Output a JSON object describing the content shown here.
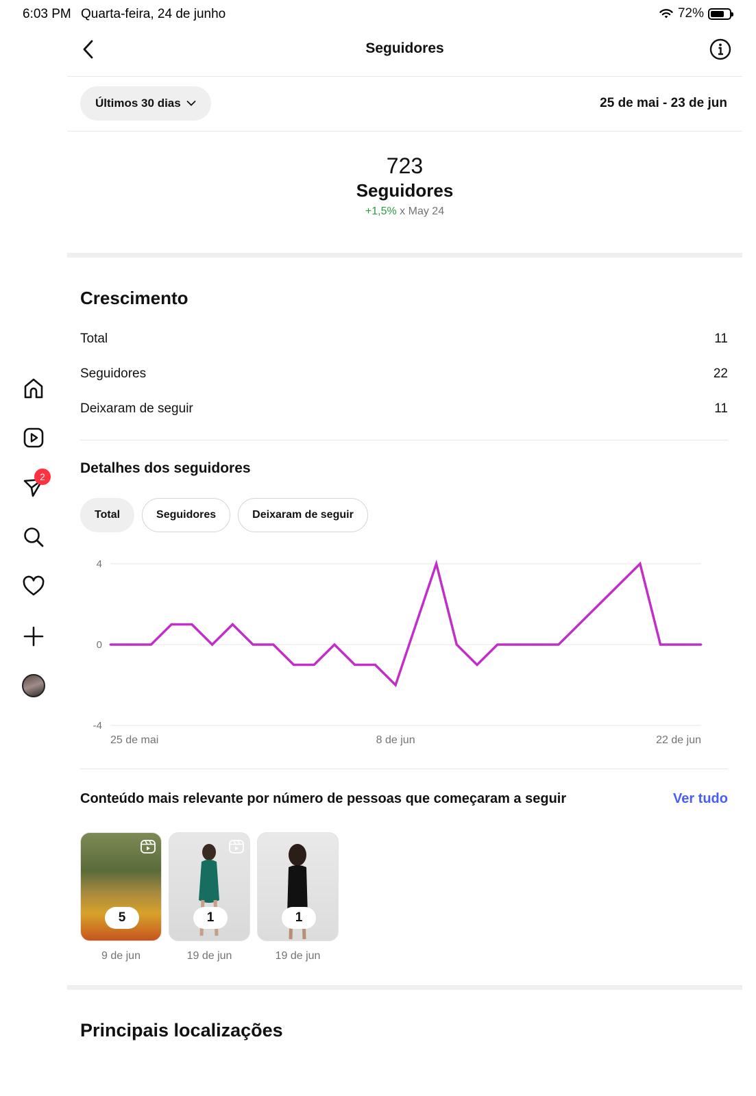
{
  "status_bar": {
    "time": "6:03 PM",
    "date": "Quarta-feira, 24 de junho",
    "battery": "72%",
    "battery_level": 0.72
  },
  "sidebar": {
    "items": [
      {
        "name": "home-icon"
      },
      {
        "name": "reels-icon"
      },
      {
        "name": "messages-icon",
        "badge": "2"
      },
      {
        "name": "search-icon"
      },
      {
        "name": "heart-icon"
      },
      {
        "name": "plus-icon"
      },
      {
        "name": "profile-avatar"
      }
    ]
  },
  "header": {
    "title": "Seguidores"
  },
  "filter": {
    "label": "Últimos 30 dias",
    "range": "25 de mai - 23 de jun"
  },
  "summary": {
    "count": "723",
    "label": "Seguidores",
    "delta": "+1,5%",
    "comparison": "x May 24"
  },
  "growth": {
    "title": "Crescimento",
    "rows": [
      {
        "label": "Total",
        "value": "11"
      },
      {
        "label": "Seguidores",
        "value": "22"
      },
      {
        "label": "Deixaram de seguir",
        "value": "11"
      }
    ]
  },
  "details": {
    "title": "Detalhes dos seguidores",
    "pills": [
      "Total",
      "Seguidores",
      "Deixaram de seguir"
    ],
    "active_pill": "Total"
  },
  "chart_data": {
    "type": "line",
    "color": "#c12fc6",
    "ylim": [
      -4,
      4
    ],
    "y_ticks": [
      "4",
      "0",
      "-4"
    ],
    "x_tick_labels": [
      "25 de mai",
      "8 de jun",
      "22 de jun"
    ],
    "x": [
      "25 de mai",
      "26 de mai",
      "27 de mai",
      "28 de mai",
      "29 de mai",
      "30 de mai",
      "31 de mai",
      "1 de jun",
      "2 de jun",
      "3 de jun",
      "4 de jun",
      "5 de jun",
      "6 de jun",
      "7 de jun",
      "8 de jun",
      "9 de jun",
      "10 de jun",
      "11 de jun",
      "12 de jun",
      "13 de jun",
      "14 de jun",
      "15 de jun",
      "16 de jun",
      "17 de jun",
      "18 de jun",
      "19 de jun",
      "20 de jun",
      "21 de jun",
      "22 de jun",
      "23 de jun"
    ],
    "values": [
      0,
      0,
      0,
      1,
      1,
      0,
      1,
      0,
      0,
      -1,
      -1,
      0,
      -1,
      -1,
      -2,
      1,
      4,
      0,
      -1,
      0,
      0,
      0,
      0,
      1,
      2,
      3,
      4,
      0,
      0,
      0
    ],
    "grid": true
  },
  "content": {
    "title": "Conteúdo mais relevante por número de pessoas que começaram a seguir",
    "see_all": "Ver tudo",
    "items": [
      {
        "count": "5",
        "date": "9 de jun",
        "reel": true
      },
      {
        "count": "1",
        "date": "19 de jun",
        "reel": true
      },
      {
        "count": "1",
        "date": "19 de jun",
        "reel": false
      }
    ]
  },
  "locations": {
    "title": "Principais localizações"
  }
}
